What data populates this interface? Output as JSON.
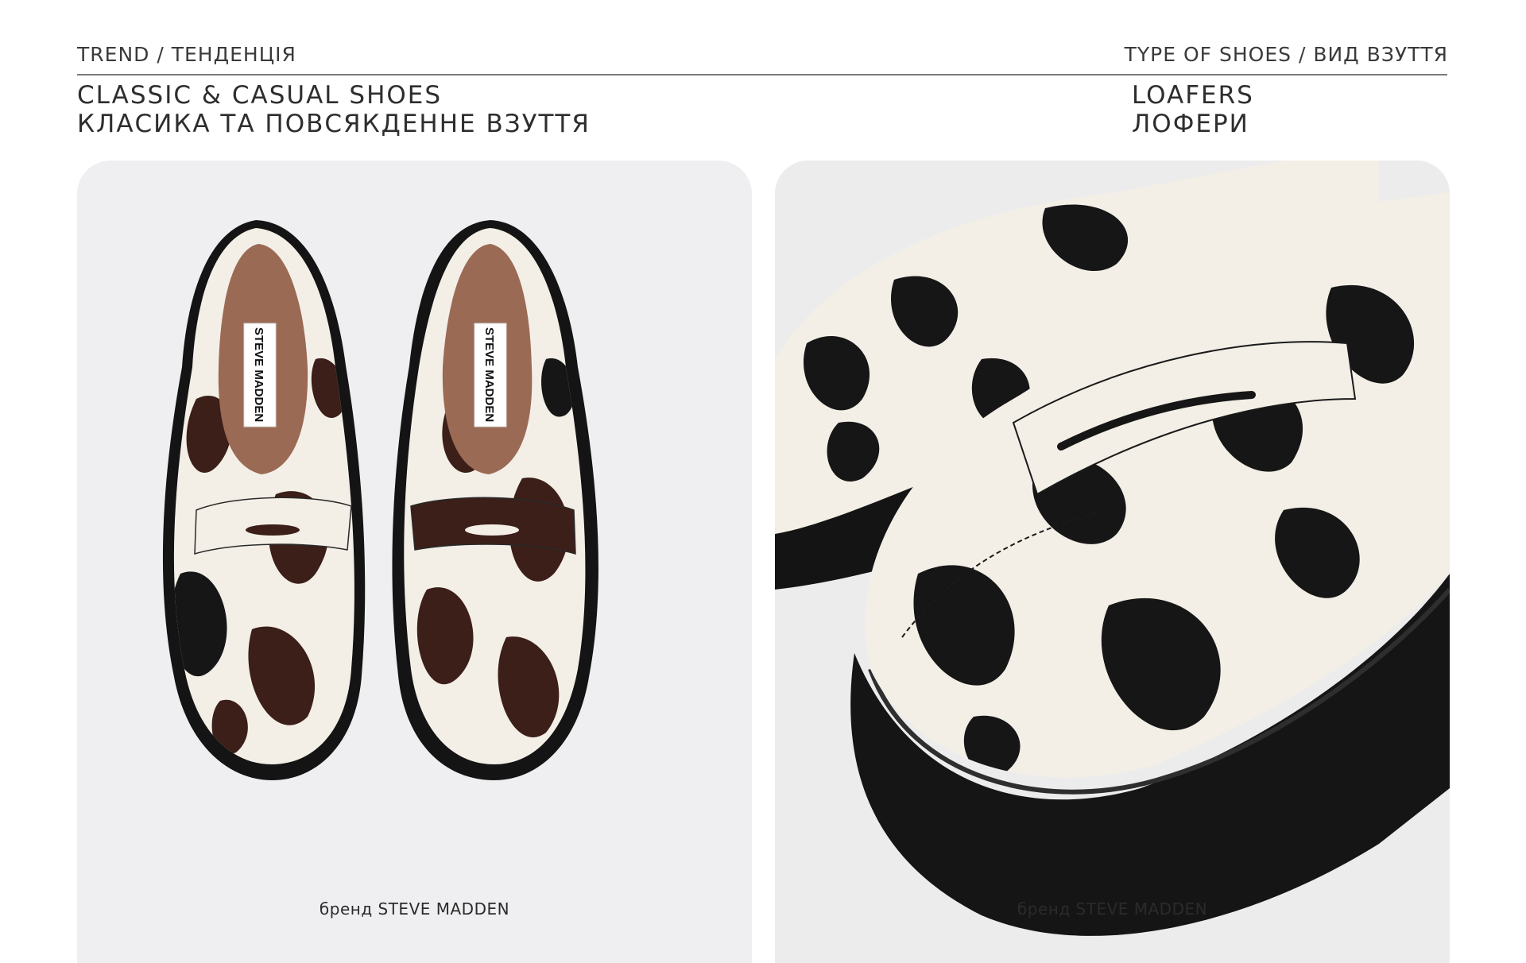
{
  "header": {
    "trend_label": "TREND / ТЕНДЕНЦІЯ",
    "type_label": "TYPE OF SHOES / ВИД ВЗУТТЯ",
    "category_en": "CLASSIC & CASUAL SHOES",
    "category_uk": "КЛАСИКА ТА ПОВСЯКДЕННЕ ВЗУТТЯ",
    "type_en": "LOAFERS",
    "type_uk": "ЛОФЕРИ"
  },
  "products": [
    {
      "caption": "бренд STEVE MADDEN",
      "insole_label": "STEVE MADDEN"
    },
    {
      "caption": "бренд STEVE MADDEN"
    }
  ],
  "colors": {
    "text": "#333333",
    "divider": "#7a7a7a",
    "card_bg": "#efeff1",
    "pattern_dark_brown": "#3b1f18",
    "pattern_black": "#161616",
    "pattern_cream": "#f3efe7",
    "lining": "#9a6a55"
  }
}
